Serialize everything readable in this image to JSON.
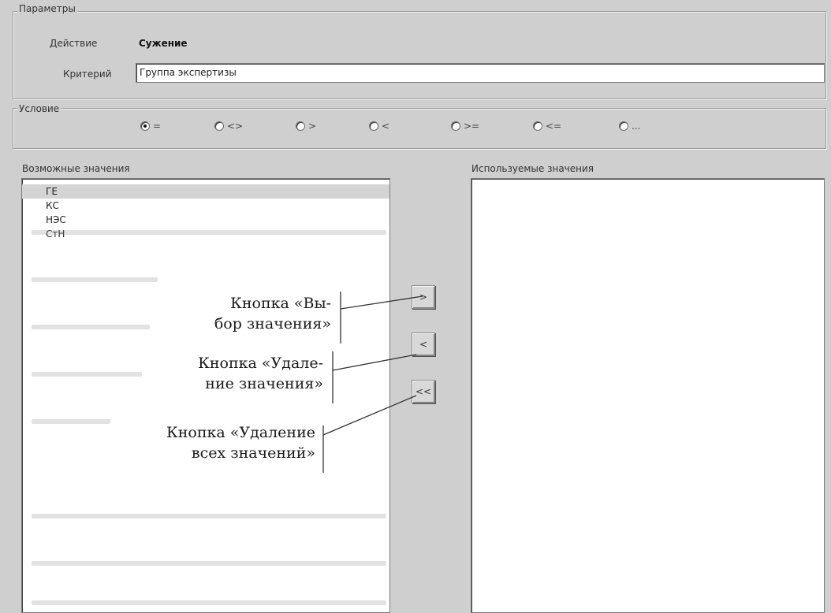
{
  "parameters": {
    "group_title": "Параметры",
    "action_label": "Действие",
    "action_value": "Сужение",
    "criterion_label": "Критерий",
    "criterion_value": "Группа экспертизы"
  },
  "conditions": {
    "group_title": "Условие",
    "options": [
      {
        "label": "=",
        "checked": true
      },
      {
        "label": "<>",
        "checked": false
      },
      {
        "label": ">",
        "checked": false
      },
      {
        "label": "<",
        "checked": false
      },
      {
        "label": ">=",
        "checked": false
      },
      {
        "label": "<=",
        "checked": false
      },
      {
        "label": "...",
        "checked": false
      }
    ]
  },
  "possible_values": {
    "title": "Возможные значения",
    "items": [
      "ГЕ",
      "КС",
      "НЭС",
      "СтН"
    ],
    "selected_index": 0
  },
  "used_values": {
    "title": "Используемые значения",
    "items": []
  },
  "buttons": {
    "select_label": ">",
    "remove_label": "<",
    "remove_all_label": "<<"
  },
  "annotations": {
    "select_button": "Кнопка «Вы-\nбор значения»",
    "remove_button": "Кнопка «Удале-\nние значения»",
    "remove_all_button": "Кнопка «Удаление\nвсех значений»"
  },
  "colors": {
    "window_bg": "#cfcfcf",
    "list_bg": "#ffffff",
    "selection_bg": "#d4d4d4"
  }
}
